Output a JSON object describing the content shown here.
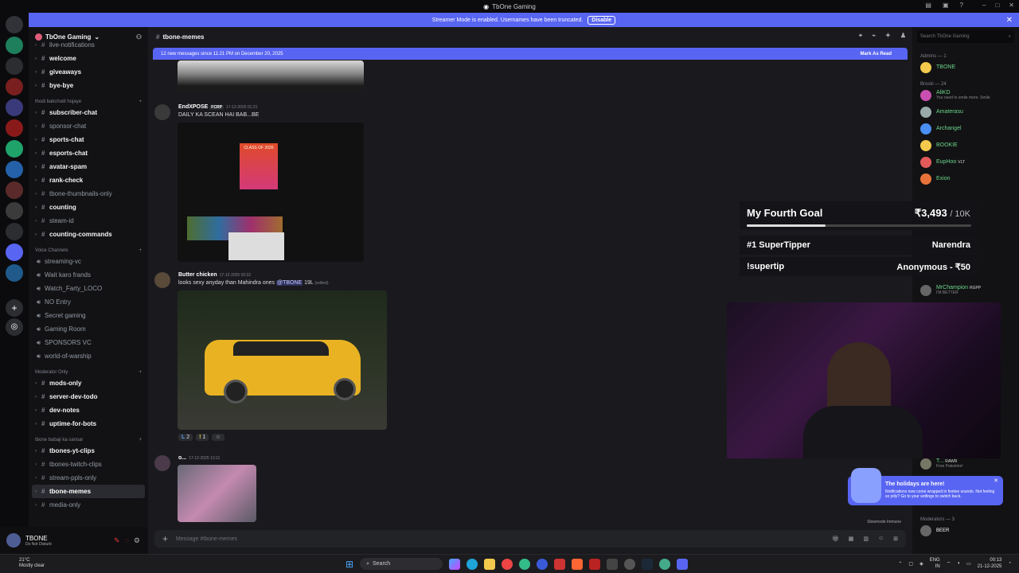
{
  "window": {
    "title": "TbOne Gaming"
  },
  "banner": {
    "text": "Streamer Mode is enabled. Usernames have been truncated.",
    "button": "Disable"
  },
  "server": {
    "name": "TbOne Gaming"
  },
  "channels": [
    {
      "type": "ch",
      "name": "live-notifications",
      "style": "dim"
    },
    {
      "type": "ch",
      "name": "welcome",
      "style": "bright"
    },
    {
      "type": "ch",
      "name": "giveaways",
      "style": "bright"
    },
    {
      "type": "ch",
      "name": "bye-bye",
      "style": "bright"
    },
    {
      "type": "cat",
      "name": "thodi bakchodi hojaye"
    },
    {
      "type": "ch",
      "name": "subscriber-chat",
      "style": "bright"
    },
    {
      "type": "ch",
      "name": "sponsor-chat",
      "style": "dim"
    },
    {
      "type": "ch",
      "name": "sports-chat",
      "style": "bright"
    },
    {
      "type": "ch",
      "name": "esports-chat",
      "style": "bright"
    },
    {
      "type": "ch",
      "name": "avatar-spam",
      "style": "bright"
    },
    {
      "type": "ch",
      "name": "rank-check",
      "style": "bright"
    },
    {
      "type": "ch",
      "name": "tbone-thumbnails-only",
      "style": "dim"
    },
    {
      "type": "ch",
      "name": "counting",
      "style": "bright"
    },
    {
      "type": "ch",
      "name": "steam-id",
      "style": "dim"
    },
    {
      "type": "ch",
      "name": "counting-commands",
      "style": "bright"
    },
    {
      "type": "cat",
      "name": "Voice Channels"
    },
    {
      "type": "vc",
      "name": "streaming-vc"
    },
    {
      "type": "vc",
      "name": "Wait karo frands"
    },
    {
      "type": "vc",
      "name": "Watch_Farty_LOCO"
    },
    {
      "type": "vc",
      "name": "NO Entry"
    },
    {
      "type": "vc",
      "name": "Secret gaming"
    },
    {
      "type": "vc",
      "name": "Gaming Room"
    },
    {
      "type": "vc",
      "name": "SPONSORS VC"
    },
    {
      "type": "vc",
      "name": "world-of-warship"
    },
    {
      "type": "cat",
      "name": "Moderator Only"
    },
    {
      "type": "ch",
      "name": "mods-only",
      "style": "bright"
    },
    {
      "type": "ch",
      "name": "server-dev-todo",
      "style": "bright"
    },
    {
      "type": "ch",
      "name": "dev-notes",
      "style": "bright"
    },
    {
      "type": "ch",
      "name": "uptime-for-bots",
      "style": "bright"
    },
    {
      "type": "cat",
      "name": "tbone babaji ka sansar"
    },
    {
      "type": "ch",
      "name": "tbones-yt-clips",
      "style": "bright"
    },
    {
      "type": "ch",
      "name": "tbones-twitch-clips",
      "style": "dim"
    },
    {
      "type": "ch",
      "name": "stream-ppls-only",
      "style": "dim"
    },
    {
      "type": "ch",
      "name": "tbone-memes",
      "style": "active"
    },
    {
      "type": "ch",
      "name": "media-only",
      "style": "dim"
    }
  ],
  "user": {
    "name": "TBONE",
    "status": "Do Not Disturb"
  },
  "channel_header": {
    "name": "tbone-memes"
  },
  "new_messages": {
    "text": "12 new messages since 11:21 PM on December 20, 2025",
    "mark": "Mark As Read"
  },
  "messages": [
    {
      "author": "EndXPOSE",
      "tag": "FCRP",
      "time": "17-12-2025 01:21",
      "text": "DAILY KA SCEAN HAI BAB...BE",
      "image_text": "CLASS OF 2026"
    },
    {
      "author": "Butter chicken",
      "time": "17-12-2025 02:32",
      "text_before": "looks sexy anyday than Mahindra ones ",
      "mention": "@TBONE",
      "text_after": " 19L",
      "edited": "(edited)",
      "reactions": [
        {
          "emoji": "L",
          "count": "2"
        },
        {
          "emoji": "!",
          "count": "1"
        }
      ]
    },
    {
      "author": "o...",
      "time": "17-12-2025 13:11"
    }
  ],
  "composer": {
    "placeholder": "Message #tbone-memes",
    "slowmode": "Slowmode Immune"
  },
  "member_search": {
    "placeholder": "Search TbOne Gaming"
  },
  "member_groups": [
    {
      "label": "Admins — 1",
      "members": [
        {
          "name": "TBONE",
          "color": "#6bd68a"
        }
      ]
    },
    {
      "label": "Broski — 24",
      "members": [
        {
          "name": "AliKD",
          "color": "#6bd68a",
          "status": "You need to smile more. Smile"
        },
        {
          "name": "Amaterasu",
          "color": "#6bd68a"
        },
        {
          "name": "Archangel",
          "color": "#6bd68a"
        },
        {
          "name": "BOOKIE",
          "color": "#6bd68a"
        },
        {
          "name": "EupHoo",
          "color": "#6bd68a",
          "tag": "VLT"
        },
        {
          "name": "Exion",
          "color": "#6bd68a"
        }
      ]
    }
  ],
  "member_lower": [
    {
      "name": "MrChampion",
      "tag": "RGPP",
      "status": "I'M BETTER"
    },
    {
      "name": "T...",
      "tag": "RAWR",
      "status": "Free Palestine!"
    }
  ],
  "moderators": {
    "label": "Moderators — 3",
    "first_tag": "BEER"
  },
  "goal": {
    "title": "My Fourth Goal",
    "amount": "₹3,493",
    "target": "/ 10K",
    "progress": 0.35,
    "rows": [
      {
        "left": "#1 SuperTipper",
        "right": "Narendra"
      },
      {
        "left": "!supertip",
        "right": "Anonymous - ₹50"
      }
    ]
  },
  "toast": {
    "title": "The holidays are here!",
    "body": "Notifications now come wrapped in festive sounds. Not feeling so jolly? Go to your settings to switch back.",
    "link": "festive sounds"
  },
  "taskbar": {
    "temp": "21°C",
    "weather": "Mostly clear",
    "search": "Search",
    "lang1": "ENG",
    "lang2": "IN",
    "time": "00:13",
    "date": "21-12-2025"
  },
  "colors": {
    "accent": "#5865f2",
    "bg": "#1a1a1e",
    "sidebar": "#121214",
    "online": "#6bd68a"
  }
}
